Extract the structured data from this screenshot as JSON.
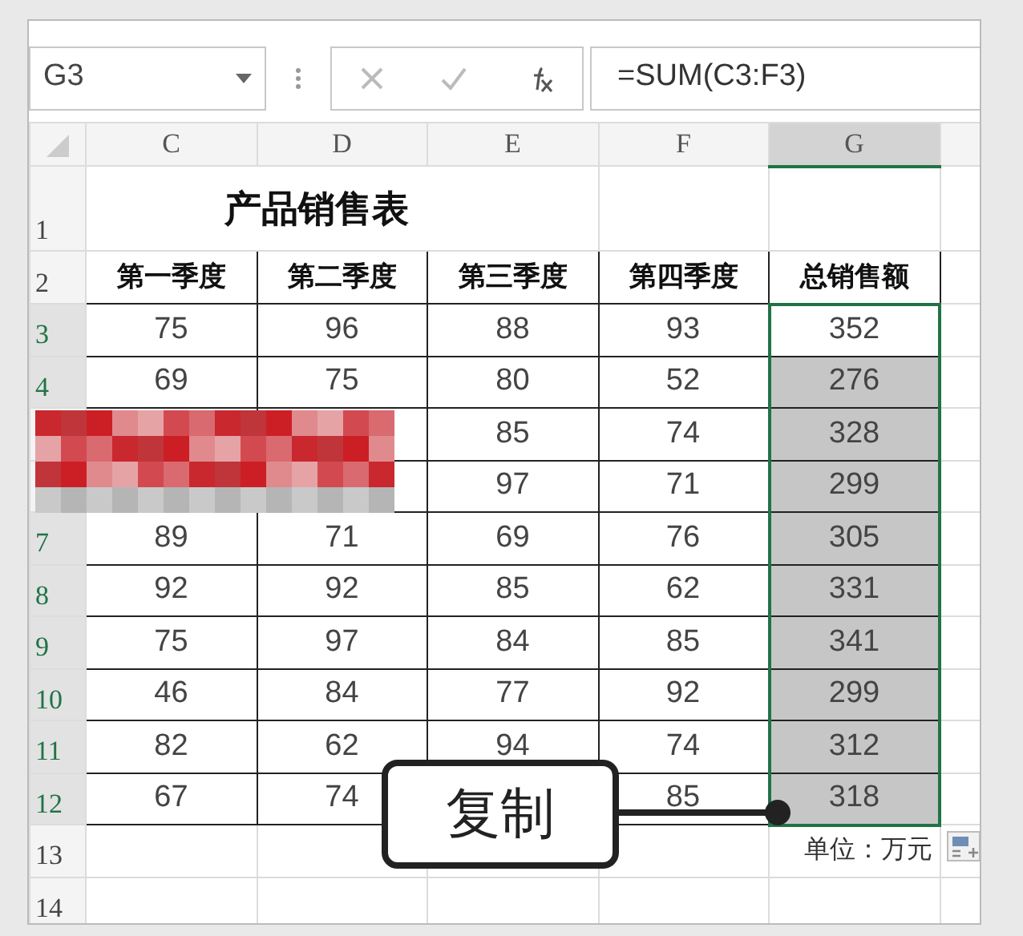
{
  "name_box": {
    "value": "G3"
  },
  "formula_bar": {
    "formula": "=SUM(C3:F3)"
  },
  "columns": [
    {
      "label": "C",
      "selected": false
    },
    {
      "label": "D",
      "selected": false
    },
    {
      "label": "E",
      "selected": false
    },
    {
      "label": "F",
      "selected": false
    },
    {
      "label": "G",
      "selected": true
    }
  ],
  "title_row": {
    "header": "1",
    "selected": false,
    "title": "产品销售表"
  },
  "header_row": {
    "header": "2",
    "selected": false,
    "cells": [
      "第一季度",
      "第二季度",
      "第三季度",
      "第四季度",
      "总销售额"
    ]
  },
  "data_rows": [
    {
      "header": "3",
      "selected": true,
      "cells": [
        "75",
        "96",
        "88",
        "93",
        "352"
      ],
      "total_highlighted": false
    },
    {
      "header": "4",
      "selected": true,
      "cells": [
        "69",
        "75",
        "80",
        "52",
        "276"
      ],
      "total_highlighted": true
    },
    {
      "cells": [
        null,
        null,
        "85",
        "74",
        "328"
      ],
      "total_highlighted": true
    },
    {
      "cells": [
        null,
        null,
        "97",
        "71",
        "299"
      ],
      "total_highlighted": true
    },
    {
      "header": "7",
      "selected": true,
      "cells": [
        "89",
        "71",
        "69",
        "76",
        "305"
      ],
      "total_highlighted": true
    },
    {
      "header": "8",
      "selected": true,
      "cells": [
        "92",
        "92",
        "85",
        "62",
        "331"
      ],
      "total_highlighted": true
    },
    {
      "header": "9",
      "selected": true,
      "cells": [
        "75",
        "97",
        "84",
        "85",
        "341"
      ],
      "total_highlighted": true
    },
    {
      "header": "10",
      "selected": true,
      "cells": [
        "46",
        "84",
        "77",
        "92",
        "299"
      ],
      "total_highlighted": true
    },
    {
      "header": "11",
      "selected": true,
      "cells": [
        "82",
        "62",
        "94",
        "74",
        "312"
      ],
      "total_highlighted": true
    },
    {
      "header": "12",
      "selected": true,
      "cells": [
        "67",
        "74",
        null,
        "85",
        "318"
      ],
      "total_highlighted": true
    }
  ],
  "note_row": {
    "header": "13",
    "selected": false,
    "note": "单位：万元"
  },
  "empty_row": {
    "header": "14",
    "selected": false
  },
  "callout": {
    "label": "复制"
  }
}
